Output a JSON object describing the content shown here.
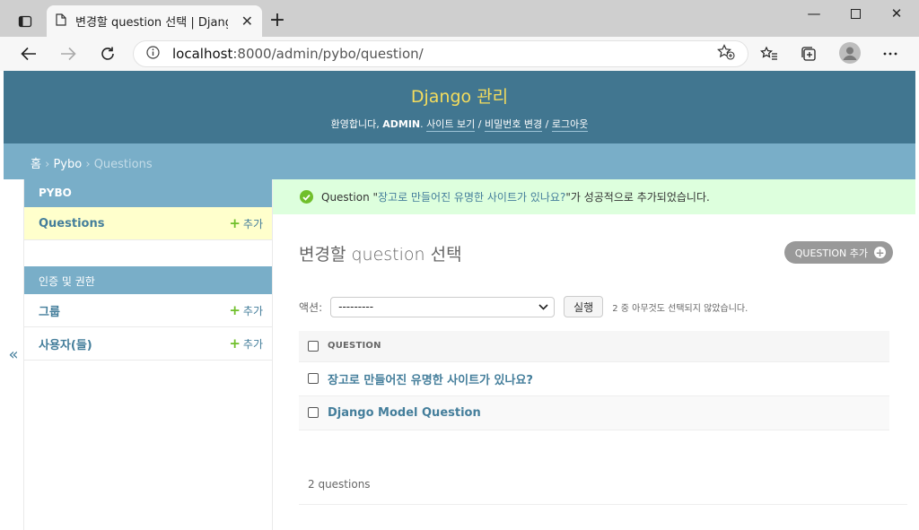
{
  "browser": {
    "tab_title": "변경할 question 선택 | Django 사이트 관리",
    "url_host": "localhost",
    "url_path": ":8000/admin/pybo/question/"
  },
  "header": {
    "site_title": "Django 관리",
    "welcome": "환영합니다,",
    "username": "ADMIN",
    "view_site": "사이트 보기",
    "change_password": "비밀번호 변경",
    "logout": "로그아웃",
    "sep": "/"
  },
  "breadcrumbs": {
    "home": "홈",
    "app": "Pybo",
    "current": "Questions",
    "sep": "›"
  },
  "sidebar": {
    "toggle": "«",
    "modules": [
      {
        "caption": "PYBO",
        "rows": [
          {
            "label": "Questions",
            "add": "추가"
          }
        ]
      },
      {
        "caption": "인증 및 권한",
        "rows": [
          {
            "label": "그룹",
            "add": "추가"
          },
          {
            "label": "사용자(들)",
            "add": "추가"
          }
        ]
      }
    ]
  },
  "message": {
    "prefix": "Question \"",
    "object": "장고로 만들어진 유명한 사이트가 있나요?",
    "suffix": "\"가 성공적으로 추가되었습니다."
  },
  "main": {
    "title": "변경할 question 선택",
    "add_button": "QUESTION 추가",
    "actions_label": "액션:",
    "action_selected": "---------",
    "go_button": "실행",
    "action_counter": "2 중 아무것도 선택되지 않았습니다.",
    "column_header": "QUESTION",
    "rows": [
      "장고로 만들어진 유명한 사이트가 있나요?",
      "Django Model Question"
    ],
    "paginator": "2 questions"
  },
  "colors": {
    "header_bg": "#417690",
    "branding": "#f5dd5d",
    "breadcrumb_bg": "#79aec8",
    "link": "#447e9b",
    "success_bg": "#ddffdd",
    "add_green": "#70bf2b"
  }
}
